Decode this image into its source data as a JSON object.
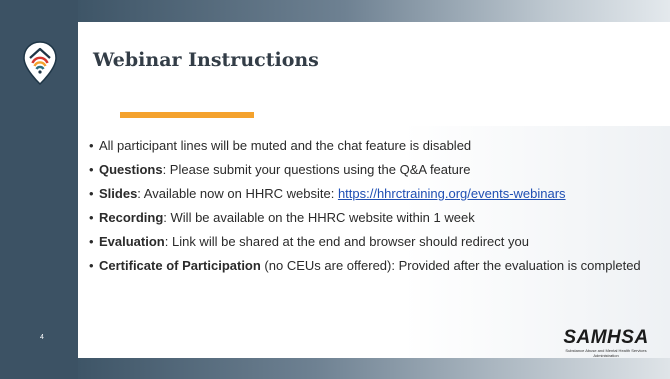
{
  "slide": {
    "title": "Webinar Instructions",
    "page_number": "4",
    "bullets": [
      {
        "bold": "",
        "text": "All participant lines will be muted and the chat feature is disabled"
      },
      {
        "bold": "Questions",
        "text": ": Please submit your questions using the Q&A feature"
      },
      {
        "bold": "Slides",
        "text": ": Available now on HHRC website: ",
        "link": "https://hhrctraining.org/events-webinars"
      },
      {
        "bold": "Recording",
        "text": ": Will be available on the HHRC website within 1 week"
      },
      {
        "bold": "Evaluation",
        "text": ": Link will be shared at the end and browser should redirect you"
      },
      {
        "bold": "Certificate of Participation",
        "text": " (no CEUs are offered): Provided after the evaluation is completed"
      }
    ]
  },
  "footer_logo": {
    "word": "SAMHSA",
    "subtitle": "Substance Abuse and Mental Health Services Administration"
  },
  "icons": {
    "header_logo": "location-pin-house-icon"
  },
  "colors": {
    "left_band": "#3c5264",
    "accent": "#f4a22d",
    "title_text": "#333d47",
    "link": "#1f4fb3",
    "logo_teal": "#2c6e7f",
    "logo_red": "#d6392e"
  }
}
